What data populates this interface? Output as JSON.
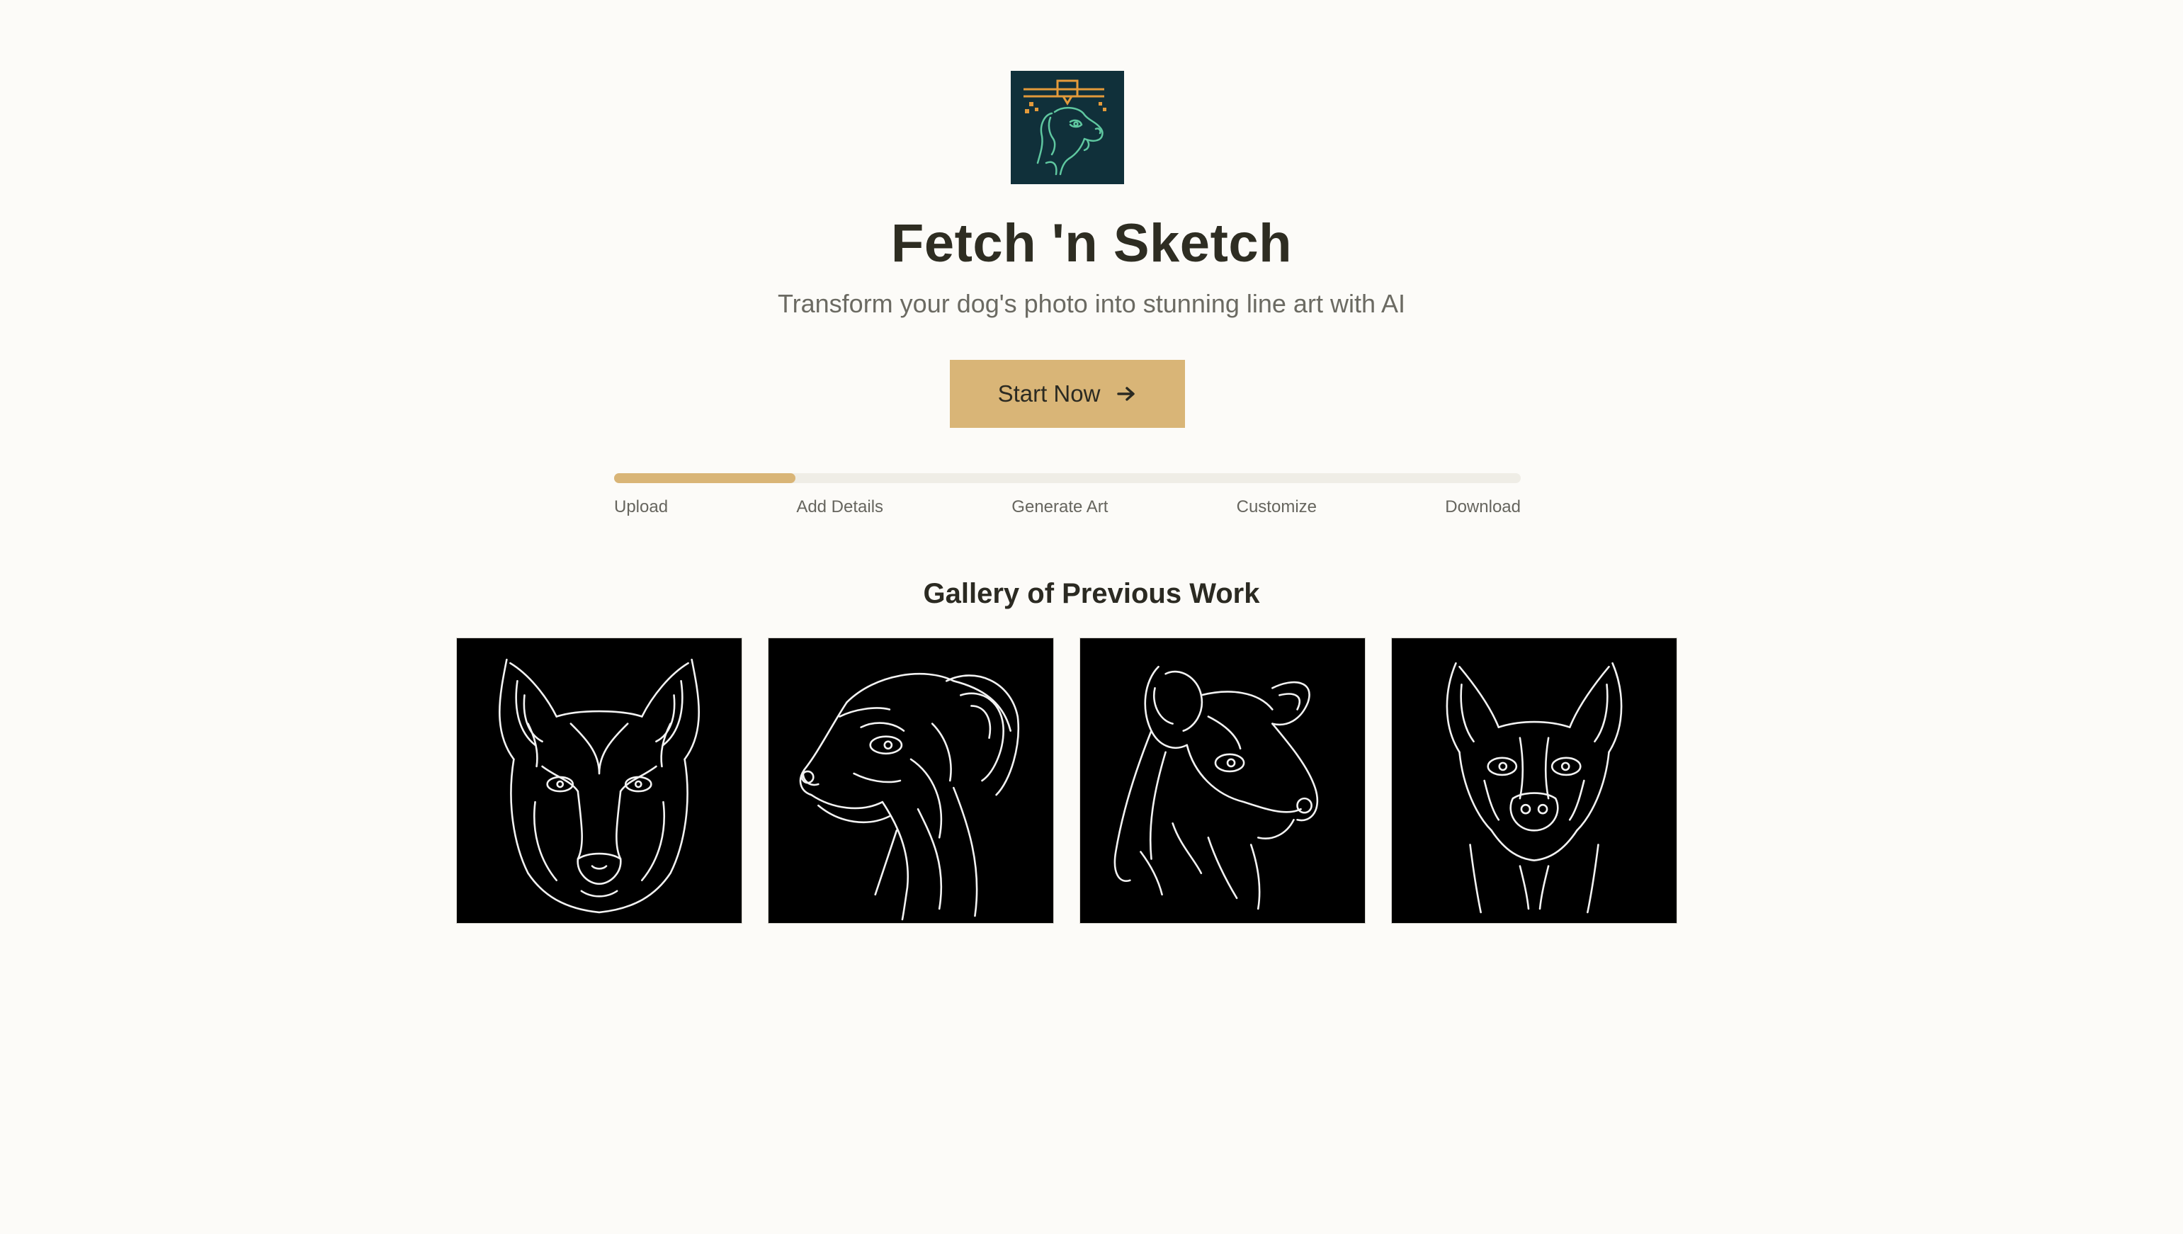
{
  "app": {
    "logo_icon": "dog-line-art-plotter-logo",
    "title": "Fetch 'n Sketch",
    "subtitle": "Transform your dog's photo into stunning line art with AI"
  },
  "cta": {
    "label": "Start Now",
    "icon": "arrow-right-icon"
  },
  "progress": {
    "fraction": 0.2,
    "steps": [
      "Upload",
      "Add Details",
      "Generate Art",
      "Customize",
      "Download"
    ]
  },
  "gallery": {
    "title": "Gallery of Previous Work",
    "items": [
      {
        "subject": "german-shepherd-line-art"
      },
      {
        "subject": "hound-profile-line-art"
      },
      {
        "subject": "border-collie-line-art"
      },
      {
        "subject": "pinscher-line-art"
      }
    ]
  },
  "colors": {
    "background": "#fcfbf8",
    "accent": "#d9b577",
    "track": "#efede6",
    "logo_bg": "#10303a",
    "logo_green": "#5fc7a0",
    "logo_orange": "#e39a3b",
    "text": "#2e2d22",
    "muted": "#6b6a62"
  }
}
